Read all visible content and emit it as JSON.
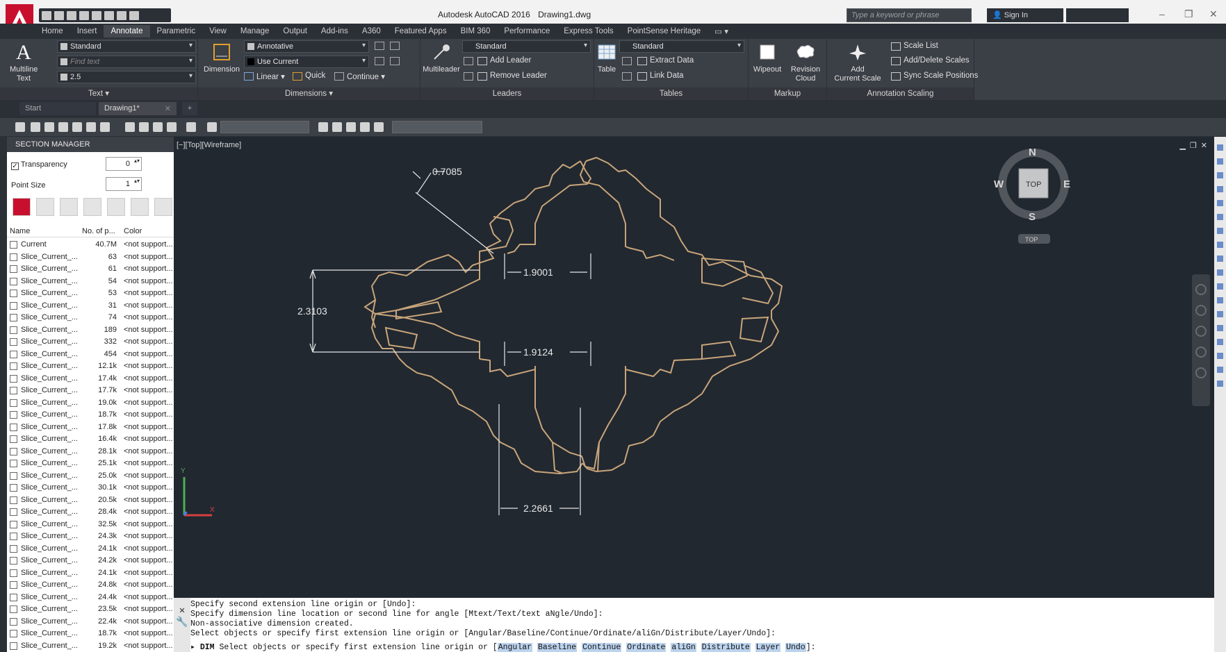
{
  "titlebar": {
    "app_name": "Autodesk AutoCAD 2016",
    "file_name": "Drawing1.dwg",
    "search_placeholder": "Type a keyword or phrase",
    "sign_in": "Sign In"
  },
  "ribbon_tabs": [
    "Home",
    "Insert",
    "Annotate",
    "Parametric",
    "View",
    "Manage",
    "Output",
    "Add-ins",
    "A360",
    "Featured Apps",
    "BIM 360",
    "Performance",
    "Express Tools",
    "PointSense Heritage"
  ],
  "active_tab": "Annotate",
  "text_panel": {
    "title": "Text",
    "multiline_label_1": "Multiline",
    "multiline_label_2": "Text",
    "style": "Standard",
    "find_placeholder": "Find text",
    "height": "2.5"
  },
  "dimensions_panel": {
    "title": "Dimensions",
    "dimension_label": "Dimension",
    "style": "Annotative",
    "layer": "Use Current",
    "linear": "Linear",
    "quick": "Quick",
    "continue": "Continue"
  },
  "leaders_panel": {
    "title": "Leaders",
    "multileader_label": "Multileader",
    "style": "Standard",
    "add_leader": "Add Leader",
    "remove_leader": "Remove Leader"
  },
  "tables_panel": {
    "title": "Tables",
    "table_label": "Table",
    "style": "Standard",
    "extract_data": "Extract Data",
    "link_data": "Link Data"
  },
  "markup_panel": {
    "title": "Markup",
    "wipeout": "Wipeout",
    "revision_1": "Revision",
    "revision_2": "Cloud"
  },
  "annotation_scaling_panel": {
    "title": "Annotation Scaling",
    "add_scale_1": "Add",
    "add_scale_2": "Current Scale",
    "scale_list": "Scale List",
    "add_delete_scales": "Add/Delete Scales",
    "sync_scale_positions": "Sync Scale Positions"
  },
  "file_tabs": [
    "Start",
    "Drawing1*"
  ],
  "section_manager": {
    "title": "SECTION MANAGER",
    "transparency_label": "Transparency",
    "transparency_value": "0",
    "point_size_label": "Point Size",
    "point_size_value": "1",
    "columns": [
      "Name",
      "No. of p...",
      "Color"
    ],
    "rows": [
      {
        "name": "Current",
        "count": "40.7M",
        "color": "<not support..."
      },
      {
        "name": "Slice_Current_...",
        "count": "63",
        "color": "<not support..."
      },
      {
        "name": "Slice_Current_...",
        "count": "61",
        "color": "<not support..."
      },
      {
        "name": "Slice_Current_...",
        "count": "54",
        "color": "<not support..."
      },
      {
        "name": "Slice_Current_...",
        "count": "53",
        "color": "<not support..."
      },
      {
        "name": "Slice_Current_...",
        "count": "31",
        "color": "<not support..."
      },
      {
        "name": "Slice_Current_...",
        "count": "74",
        "color": "<not support..."
      },
      {
        "name": "Slice_Current_...",
        "count": "189",
        "color": "<not support..."
      },
      {
        "name": "Slice_Current_...",
        "count": "332",
        "color": "<not support..."
      },
      {
        "name": "Slice_Current_...",
        "count": "454",
        "color": "<not support..."
      },
      {
        "name": "Slice_Current_...",
        "count": "12.1k",
        "color": "<not support..."
      },
      {
        "name": "Slice_Current_...",
        "count": "17.4k",
        "color": "<not support..."
      },
      {
        "name": "Slice_Current_...",
        "count": "17.7k",
        "color": "<not support..."
      },
      {
        "name": "Slice_Current_...",
        "count": "19.0k",
        "color": "<not support..."
      },
      {
        "name": "Slice_Current_...",
        "count": "18.7k",
        "color": "<not support..."
      },
      {
        "name": "Slice_Current_...",
        "count": "17.8k",
        "color": "<not support..."
      },
      {
        "name": "Slice_Current_...",
        "count": "16.4k",
        "color": "<not support..."
      },
      {
        "name": "Slice_Current_...",
        "count": "28.1k",
        "color": "<not support..."
      },
      {
        "name": "Slice_Current_...",
        "count": "25.1k",
        "color": "<not support..."
      },
      {
        "name": "Slice_Current_...",
        "count": "25.0k",
        "color": "<not support..."
      },
      {
        "name": "Slice_Current_...",
        "count": "30.1k",
        "color": "<not support..."
      },
      {
        "name": "Slice_Current_...",
        "count": "20.5k",
        "color": "<not support..."
      },
      {
        "name": "Slice_Current_...",
        "count": "28.4k",
        "color": "<not support..."
      },
      {
        "name": "Slice_Current_...",
        "count": "32.5k",
        "color": "<not support..."
      },
      {
        "name": "Slice_Current_...",
        "count": "24.3k",
        "color": "<not support..."
      },
      {
        "name": "Slice_Current_...",
        "count": "24.1k",
        "color": "<not support..."
      },
      {
        "name": "Slice_Current_...",
        "count": "24.2k",
        "color": "<not support..."
      },
      {
        "name": "Slice_Current_...",
        "count": "24.1k",
        "color": "<not support..."
      },
      {
        "name": "Slice_Current_...",
        "count": "24.8k",
        "color": "<not support..."
      },
      {
        "name": "Slice_Current_...",
        "count": "24.4k",
        "color": "<not support..."
      },
      {
        "name": "Slice_Current_...",
        "count": "23.5k",
        "color": "<not support..."
      },
      {
        "name": "Slice_Current_...",
        "count": "22.4k",
        "color": "<not support..."
      },
      {
        "name": "Slice_Current_...",
        "count": "18.7k",
        "color": "<not support..."
      },
      {
        "name": "Slice_Current_...",
        "count": "19.2k",
        "color": "<not support..."
      }
    ]
  },
  "viewport": {
    "label": "[−][Top][Wireframe]",
    "dimensions": [
      "0.7085",
      "1.9001",
      "2.3103",
      "1.9124",
      "2.2661"
    ],
    "viewcube": {
      "top": "TOP",
      "n": "N",
      "s": "S",
      "e": "E",
      "w": "W",
      "wcs": "TOP"
    }
  },
  "command_line": {
    "history": [
      "Specify second extension line origin or [Undo]:",
      "Specify dimension line location or second line for angle [Mtext/Text/text aNgle/Undo]:",
      "Non-associative dimension created.",
      "Select objects or specify first extension line origin or [Angular/Baseline/Continue/Ordinate/aliGn/Distribute/Layer/Undo]:"
    ],
    "prompt_cmd": "DIM",
    "prompt_text": "Select objects or specify first extension line origin or [",
    "prompt_keywords": [
      "Angular",
      "Baseline",
      "Continue",
      "Ordinate",
      "aliGn",
      "Distribute",
      "Layer",
      "Undo"
    ],
    "prompt_end": "]:"
  },
  "colors": {
    "accent_red": "#c8102e",
    "canvas_bg": "#212830",
    "contour": "#c9a57a",
    "dimension": "#e8e8e8"
  }
}
